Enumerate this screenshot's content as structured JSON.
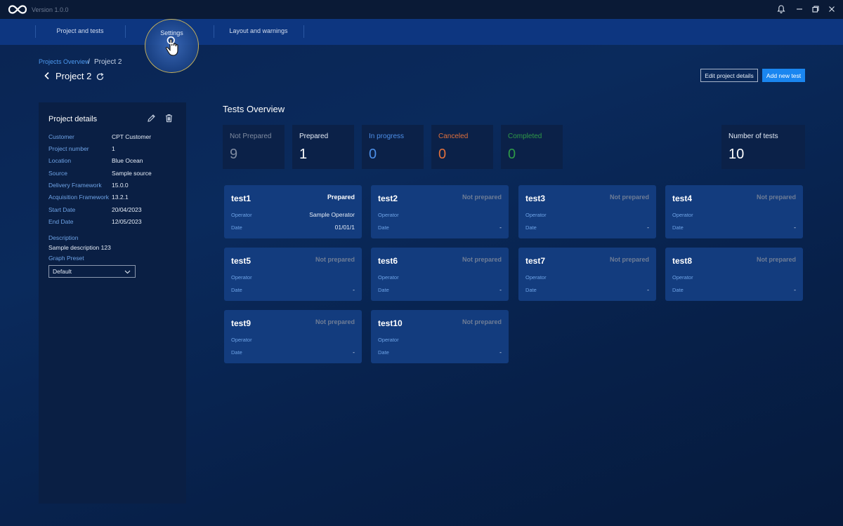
{
  "titlebar": {
    "version": "Version 1.0.0",
    "icons": [
      "infinity-logo-icon",
      "bell-icon",
      "minimize-icon",
      "restore-icon",
      "close-icon"
    ]
  },
  "nav": {
    "items": [
      {
        "label": "Project and tests"
      },
      {
        "label": "Settings"
      },
      {
        "label": "Layout and warnings"
      }
    ]
  },
  "breadcrumb": {
    "link": "Projects Overview",
    "separator": "/",
    "current": "Project 2"
  },
  "header": {
    "title": "Project 2",
    "edit_label": "Edit project details",
    "add_label": "Add new test"
  },
  "details": {
    "title": "Project details",
    "rows": [
      {
        "key": "Customer",
        "value": "CPT Customer"
      },
      {
        "key": "Project number",
        "value": "1"
      },
      {
        "key": "Location",
        "value": "Blue Ocean"
      },
      {
        "key": "Source",
        "value": "Sample source"
      },
      {
        "key": "Delivery Framework",
        "value": "15.0.0"
      },
      {
        "key": "Acquisition Framework",
        "value": "13.2.1"
      },
      {
        "key": "Start Date",
        "value": "20/04/2023"
      },
      {
        "key": "End Date",
        "value": "12/05/2023"
      }
    ],
    "description_label": "Description",
    "description_value": "Sample description 123",
    "graph_preset_label": "Graph Preset",
    "graph_preset_value": "Default"
  },
  "overview": {
    "title": "Tests Overview",
    "stats": [
      {
        "label": "Not Prepared",
        "value": "9",
        "label_color": "#7f8ba0",
        "value_color": "#7f8ba0"
      },
      {
        "label": "Prepared",
        "value": "1",
        "label_color": "#e6edf7",
        "value_color": "#ffffff"
      },
      {
        "label": "In progress",
        "value": "0",
        "label_color": "#4d8fe8",
        "value_color": "#4d8fe8"
      },
      {
        "label": "Canceled",
        "value": "0",
        "label_color": "#e0703c",
        "value_color": "#e0703c"
      },
      {
        "label": "Completed",
        "value": "0",
        "label_color": "#2f9a47",
        "value_color": "#2f9a47"
      }
    ],
    "total": {
      "label": "Number of tests",
      "value": "10"
    }
  },
  "tests": [
    {
      "name": "test1",
      "status": "Prepared",
      "operator_label": "Operator",
      "operator": "Sample Operator",
      "date_label": "Date",
      "date": "01/01/1"
    },
    {
      "name": "test2",
      "status": "Not prepared",
      "operator_label": "Operator",
      "operator": "",
      "date_label": "Date",
      "date": "-"
    },
    {
      "name": "test3",
      "status": "Not prepared",
      "operator_label": "Operator",
      "operator": "",
      "date_label": "Date",
      "date": "-"
    },
    {
      "name": "test4",
      "status": "Not prepared",
      "operator_label": "Operator",
      "operator": "",
      "date_label": "Date",
      "date": "-"
    },
    {
      "name": "test5",
      "status": "Not prepared",
      "operator_label": "Operator",
      "operator": "",
      "date_label": "Date",
      "date": "-"
    },
    {
      "name": "test6",
      "status": "Not prepared",
      "operator_label": "Operator",
      "operator": "",
      "date_label": "Date",
      "date": "-"
    },
    {
      "name": "test7",
      "status": "Not prepared",
      "operator_label": "Operator",
      "operator": "",
      "date_label": "Date",
      "date": "-"
    },
    {
      "name": "test8",
      "status": "Not prepared",
      "operator_label": "Operator",
      "operator": "",
      "date_label": "Date",
      "date": "-"
    },
    {
      "name": "test9",
      "status": "Not prepared",
      "operator_label": "Operator",
      "operator": "",
      "date_label": "Date",
      "date": "-"
    },
    {
      "name": "test10",
      "status": "Not prepared",
      "operator_label": "Operator",
      "operator": "",
      "date_label": "Date",
      "date": "-"
    }
  ],
  "colors": {
    "prepared_status": "#ffffff",
    "not_prepared_status": "#6f7d96",
    "accent": "#1a86f0"
  }
}
